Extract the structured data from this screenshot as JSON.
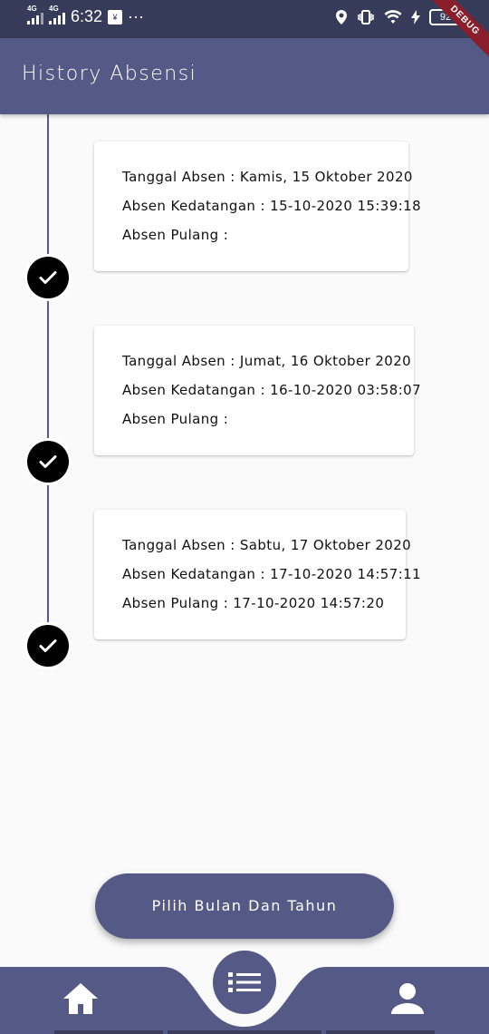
{
  "status_bar": {
    "time": "6:32",
    "network1": "4G",
    "network2": "4G",
    "dots": "···",
    "battery": "92",
    "debug": "DEBUG"
  },
  "app_bar": {
    "title": "History Absensi"
  },
  "history": [
    {
      "tanggal": "Tanggal Absen : Kamis, 15 Oktober 2020",
      "kedatangan": "Absen Kedatangan : 15-10-2020 15:39:18",
      "pulang": "Absen Pulang :"
    },
    {
      "tanggal": "Tanggal Absen : Jumat, 16 Oktober 2020",
      "kedatangan": "Absen Kedatangan : 16-10-2020 03:58:07",
      "pulang": "Absen Pulang :"
    },
    {
      "tanggal": "Tanggal Absen : Sabtu, 17 Oktober 2020",
      "kedatangan": "Absen Kedatangan : 17-10-2020 14:57:11",
      "pulang": "Absen Pulang : 17-10-2020 14:57:20"
    }
  ],
  "pick_button": {
    "label": "Pilih Bulan Dan Tahun"
  },
  "bottom_nav": {
    "items": [
      "home-icon",
      "list-icon",
      "person-icon"
    ]
  },
  "colors": {
    "primary": "#555985",
    "status_bar": "#363b59",
    "check": "#000000"
  }
}
